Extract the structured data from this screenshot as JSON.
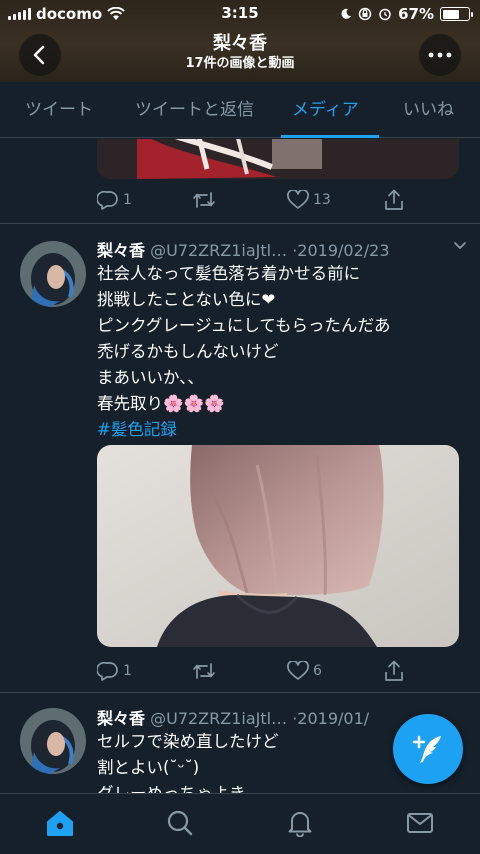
{
  "status_bar": {
    "carrier": "docomo",
    "time": "3:15",
    "battery": "67%",
    "battery_level": 0.67,
    "icons": [
      "signal-bars",
      "wifi",
      "moon",
      "rotation-lock",
      "alarm",
      "battery"
    ]
  },
  "header": {
    "title": "梨々香",
    "subtitle": "17件の画像と動画",
    "back_icon": "chevron-left",
    "more_icon": "ellipsis"
  },
  "tabs": [
    {
      "label": "ツイート",
      "active": false
    },
    {
      "label": "ツイートと返信",
      "active": false
    },
    {
      "label": "メディア",
      "active": true
    },
    {
      "label": "いいね",
      "active": false
    }
  ],
  "previous_tweet": {
    "replies": "1",
    "likes": "13"
  },
  "tweets": [
    {
      "name": "梨々香",
      "handle": "@U72ZRZ1iaJtl…",
      "date": "·2019/02/23",
      "lines": [
        "社会人なって髪色落ち着かせる前に",
        "挑戦したことない色に❤︎",
        "ピンクグレージュにしてもらったんだあ",
        "禿げるかもしんないけど",
        "まあいいか、、",
        "春先取り🌸🌸🌸"
      ],
      "hashtag": "#髪色記録",
      "replies": "1",
      "likes": "6"
    },
    {
      "name": "梨々香",
      "handle": "@U72ZRZ1iaJtl…",
      "date": "·2019/01/",
      "lines": [
        "セルフで染め直したけど",
        "割とよい(˘ᵕ˘)",
        "グレーめっちゃよき"
      ]
    }
  ],
  "fab": {
    "icon": "compose-feather-plus"
  },
  "bottom_nav": [
    {
      "name": "home",
      "icon": "home",
      "active": true
    },
    {
      "name": "search",
      "icon": "search",
      "active": false
    },
    {
      "name": "notifications",
      "icon": "bell",
      "active": false
    },
    {
      "name": "messages",
      "icon": "envelope",
      "active": false
    }
  ],
  "colors": {
    "background": "#15202b",
    "accent": "#1da1f2",
    "secondary_text": "#8899a6",
    "divider": "#38444d"
  }
}
